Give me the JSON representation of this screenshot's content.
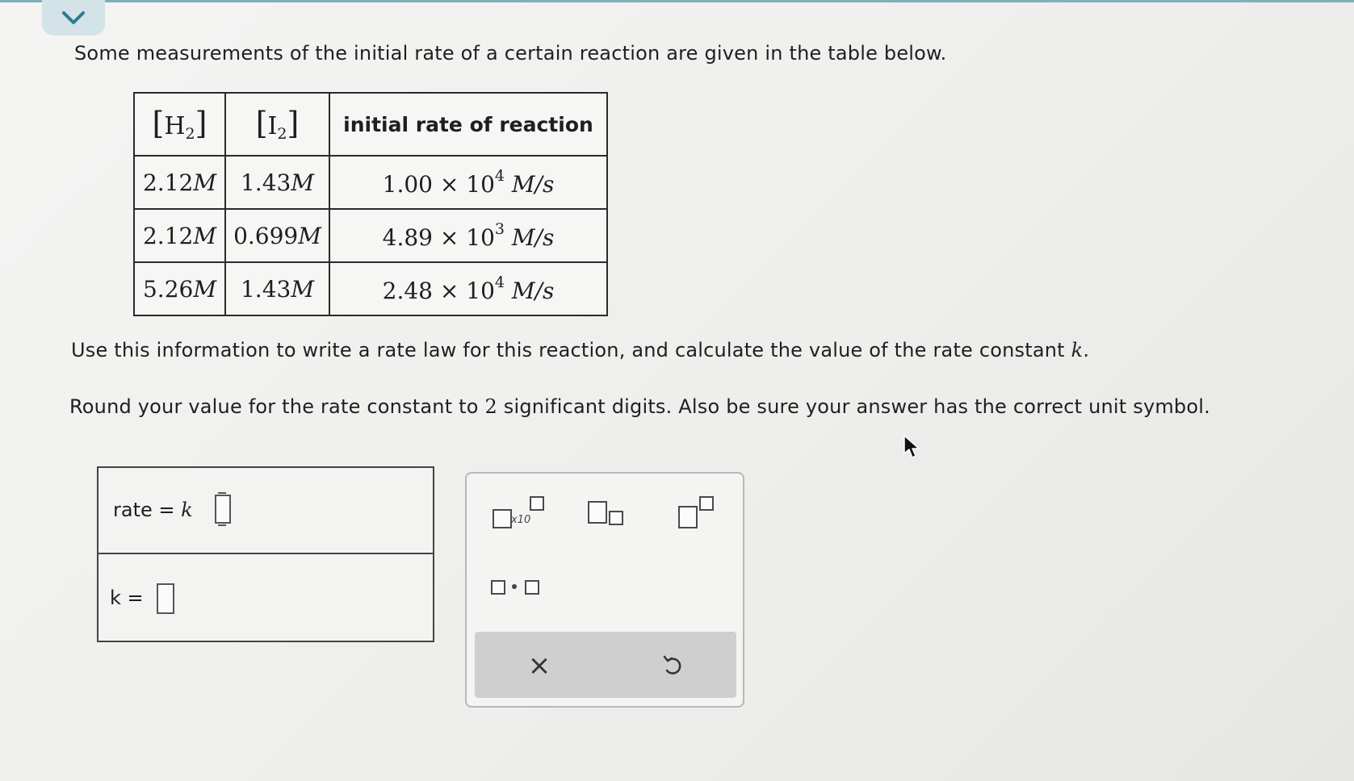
{
  "header": {
    "collapse_icon": "chevron-down-icon",
    "accent_color": "#7fb0b8"
  },
  "question": {
    "intro": "Some measurements of the initial rate of a certain reaction are given in the table below.",
    "instruction_a": "Use this information to write a rate law for this reaction, and calculate the value of the rate constant ",
    "instruction_a_var": "k",
    "instruction_a_end": ".",
    "instruction_b_start": "Round your value for the rate constant to ",
    "instruction_b_num": "2",
    "instruction_b_end": " significant digits. Also be sure your answer has the correct unit symbol."
  },
  "table": {
    "headers": [
      {
        "label": "H",
        "subscript": "2"
      },
      {
        "label": "I",
        "subscript": "2"
      },
      {
        "label": "initial rate of reaction"
      }
    ],
    "rows": [
      {
        "h2": "2.12",
        "i2": "1.43",
        "rate_mantissa": "1.00",
        "rate_exp": "4",
        "conc_unit": "M",
        "rate_unit": "M/s"
      },
      {
        "h2": "2.12",
        "i2": "0.699",
        "rate_mantissa": "4.89",
        "rate_exp": "3",
        "conc_unit": "M",
        "rate_unit": "M/s"
      },
      {
        "h2": "5.26",
        "i2": "1.43",
        "rate_mantissa": "2.48",
        "rate_exp": "4",
        "conc_unit": "M",
        "rate_unit": "M/s"
      }
    ],
    "times": "×",
    "ten": "10"
  },
  "answer": {
    "rate_label": "rate =",
    "rate_var": "k",
    "k_label": "k =",
    "rate_value": "",
    "k_value": ""
  },
  "palette": {
    "x10_label": "x10",
    "tools": [
      "scientific-notation-tool",
      "subscript-tool",
      "superscript-tool",
      "multiply-dot-tool"
    ],
    "clear_label": "×",
    "undo_icon": "undo-icon"
  }
}
